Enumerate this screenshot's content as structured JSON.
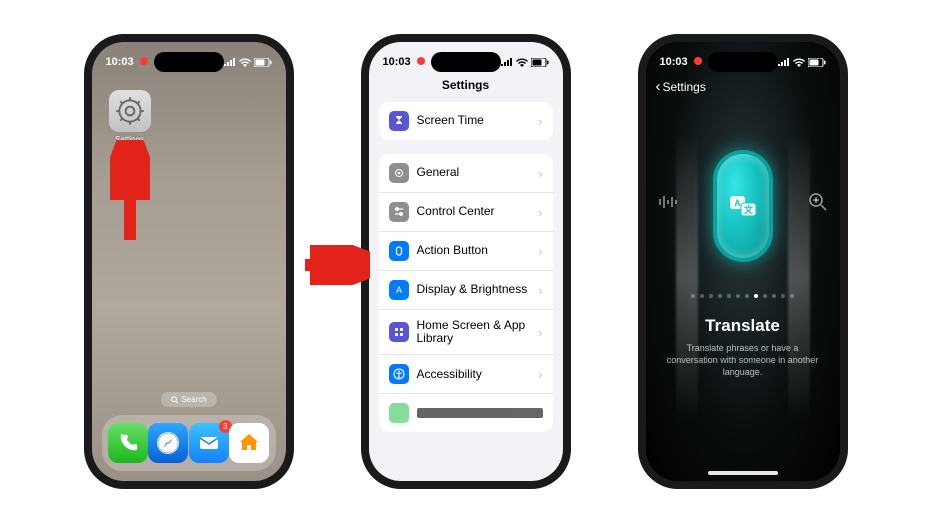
{
  "status": {
    "time": "10:03",
    "recording": true
  },
  "screen1": {
    "app_label": "Settings",
    "search_label": "Search",
    "dock": {
      "mail_badge": "3"
    }
  },
  "screen2": {
    "title": "Settings",
    "group1": [
      {
        "label": "Screen Time",
        "icon_bg": "#5856d6",
        "icon": "hourglass"
      }
    ],
    "group2": [
      {
        "label": "General",
        "icon_bg": "#8e8e93",
        "icon": "gear"
      },
      {
        "label": "Control Center",
        "icon_bg": "#8e8e93",
        "icon": "sliders"
      },
      {
        "label": "Action Button",
        "icon_bg": "#007aff",
        "icon": "action"
      },
      {
        "label": "Display & Brightness",
        "icon_bg": "#007aff",
        "icon": "display"
      },
      {
        "label": "Home Screen & App Library",
        "icon_bg": "#5856d6",
        "icon": "grid"
      },
      {
        "label": "Accessibility",
        "icon_bg": "#007aff",
        "icon": "accessibility"
      }
    ]
  },
  "screen3": {
    "back_label": "Settings",
    "title": "Translate",
    "description": "Translate phrases or have a conversation with someone in another language.",
    "page_count": 12,
    "active_page": 7
  }
}
